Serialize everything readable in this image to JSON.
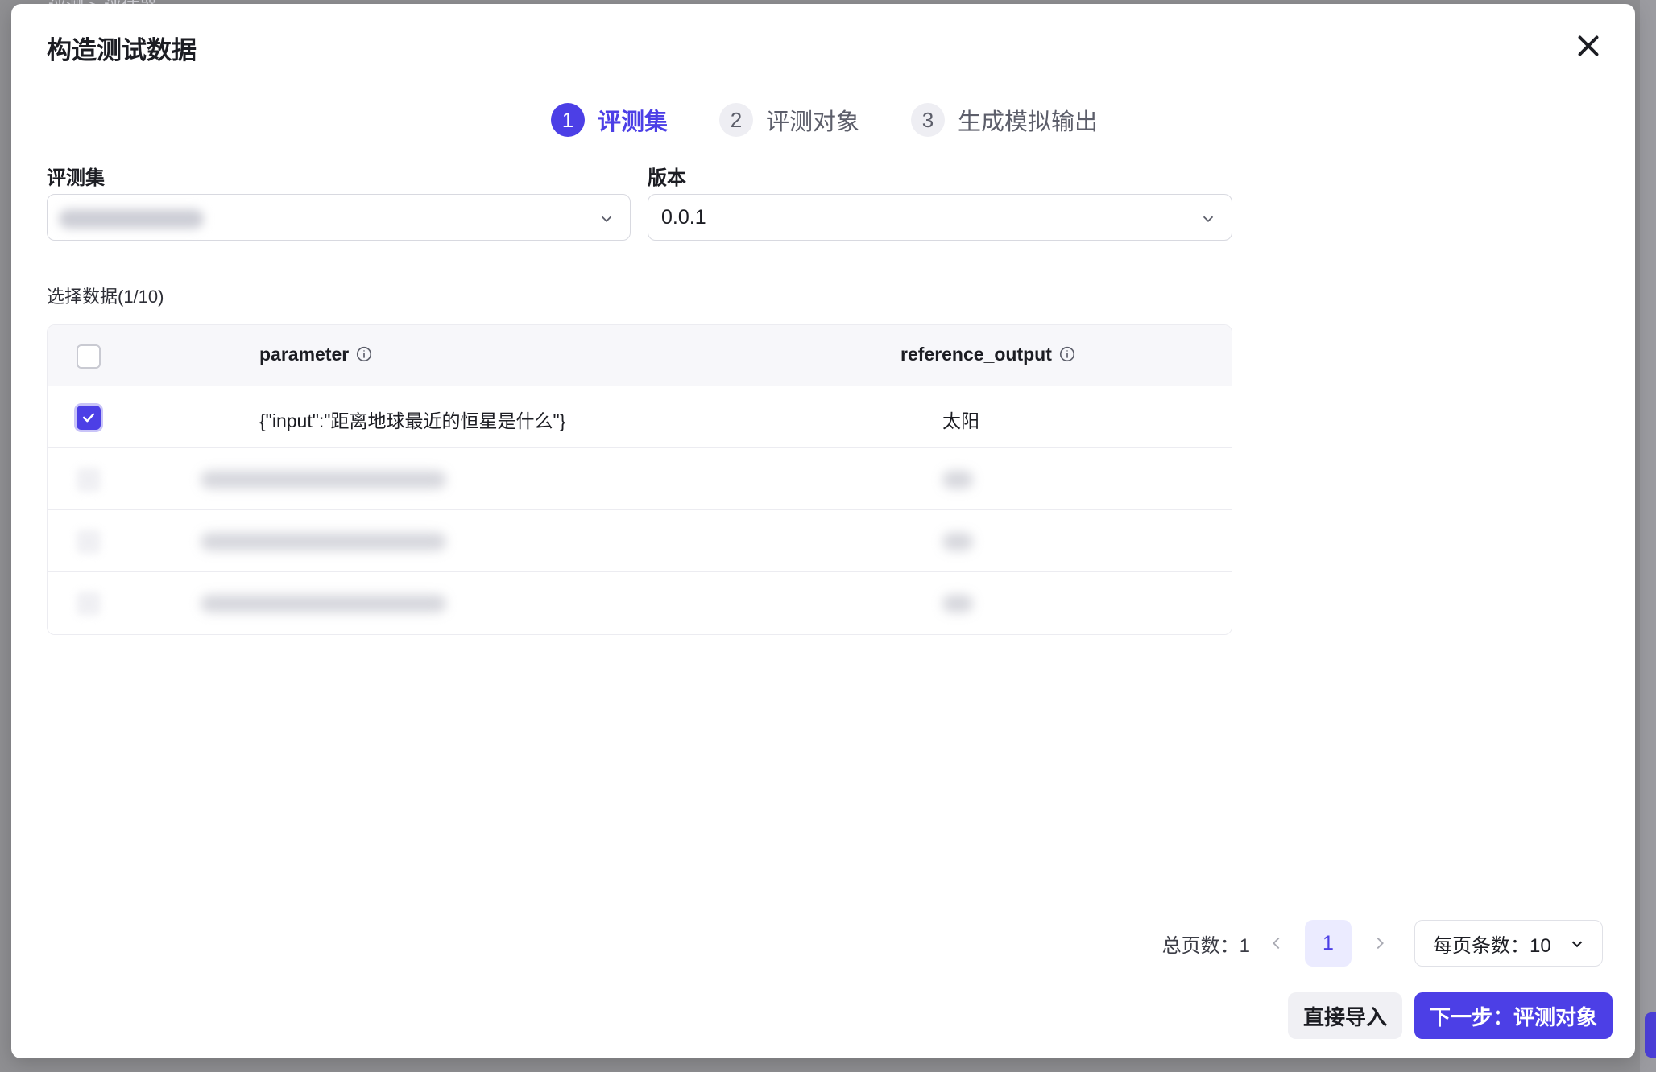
{
  "background": {
    "breadcrumb": "评测 > 评估器"
  },
  "modal": {
    "title": "构造测试数据",
    "close_icon": "close-icon"
  },
  "steps": [
    {
      "number": "1",
      "label": "评测集",
      "active": true
    },
    {
      "number": "2",
      "label": "评测对象",
      "active": false
    },
    {
      "number": "3",
      "label": "生成模拟输出",
      "active": false
    }
  ],
  "form": {
    "dataset_label": "评测集",
    "dataset_value": "",
    "version_label": "版本",
    "version_value": "0.0.1"
  },
  "table": {
    "select_label": "选择数据(1/10)",
    "columns": [
      "parameter",
      "reference_output"
    ],
    "rows": [
      {
        "checked": true,
        "parameter": "{\"input\":\"距离地球最近的恒星是什么\"}",
        "reference_output": "太阳"
      }
    ],
    "blurred_row_count": 3
  },
  "pagination": {
    "total_label": "总页数：1",
    "current_page": "1",
    "page_size_label": "每页条数：10"
  },
  "buttons": {
    "import_label": "直接导入",
    "next_label": "下一步：评测对象"
  },
  "colors": {
    "accent": "#4c3fe6",
    "accent_light": "#ebebff",
    "text_primary": "#1c1d23",
    "text_secondary": "#5c5e6a"
  }
}
